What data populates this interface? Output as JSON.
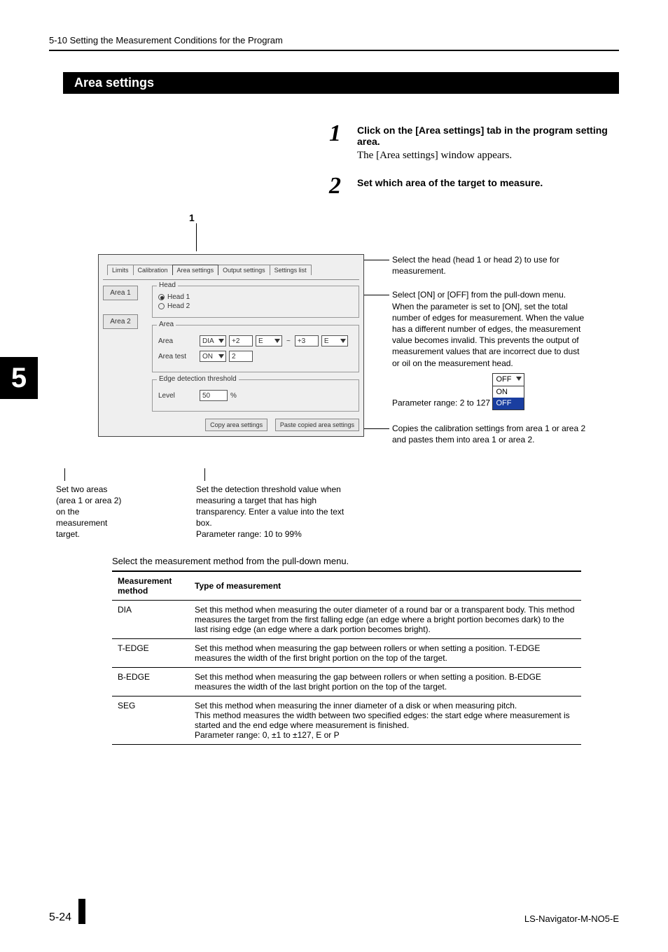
{
  "header": "5-10 Setting the Measurement Conditions for the Program",
  "chapter_tab": "5",
  "section_title": "Area settings",
  "steps": {
    "s1": {
      "num": "1",
      "bold": "Click on the [Area settings] tab in the program setting area.",
      "body": "The [Area settings] window appears."
    },
    "s2": {
      "num": "2",
      "bold": "Set which area of the target to measure."
    }
  },
  "callout_num": "1",
  "figure": {
    "tabs": {
      "t1": "Limits",
      "t2": "Calibration",
      "t3": "Area settings",
      "t4": "Output settings",
      "t5": "Settings list"
    },
    "area_buttons": {
      "a1": "Area 1",
      "a2": "Area 2"
    },
    "head_group": {
      "title": "Head",
      "h1": "Head 1",
      "h2": "Head 2"
    },
    "area_group": {
      "title": "Area",
      "row1_label": "Area",
      "row1_val": "DIA",
      "row1_e2": "+2",
      "row1_e2b": "E",
      "row1_tilde": "~",
      "row1_e3": "+3",
      "row1_e3b": "E",
      "row2_label": "Area test",
      "row2_val": "ON",
      "row2_num": "2"
    },
    "edge_group": {
      "title": "Edge detection threshold",
      "label": "Level",
      "val": "50",
      "unit": "%"
    },
    "buttons": {
      "copy": "Copy area settings",
      "paste": "Paste copied area settings"
    }
  },
  "annotations": {
    "head": "Select the head (head 1 or head 2) to use for measurement.",
    "areatest": "Select [ON] or [OFF] from the pull-down menu. When the parameter is set to [ON], set the total number of edges for measurement. When the value has a different number of edges, the measurement value becomes invalid. This prevents the output of measurement values that are incorrect due to dust or oil on the measurement head.\nParameter range: 2 to 127",
    "dd": {
      "top": "OFF",
      "r1": "ON",
      "r2": "OFF"
    },
    "copy": "Copies the calibration settings from area 1 or area 2 and pastes them into area 1 or area 2.",
    "left": "Set two areas (area 1 or area 2) on the measurement target.",
    "edge": "Set the detection threshold value when measuring a target that has high transparency. Enter a value into the text box.\nParameter range: 10 to 99%"
  },
  "table_caption": "Select the measurement method from the pull-down menu.",
  "table": {
    "h1": "Measurement method",
    "h2": "Type of measurement",
    "rows": {
      "r1": {
        "m": "DIA",
        "d": "Set this method when measuring the outer diameter of a round bar or a transparent body. This method measures the target from the first falling edge (an edge where a bright portion becomes dark) to the last rising edge (an edge where a dark portion becomes bright)."
      },
      "r2": {
        "m": "T-EDGE",
        "d": "Set this method when measuring the gap between rollers or when setting a position. T-EDGE measures the width of the first bright portion on the top of the target."
      },
      "r3": {
        "m": "B-EDGE",
        "d": "Set this method when measuring the gap between rollers or when setting a position. B-EDGE measures the width of the last bright portion on the top of the target."
      },
      "r4": {
        "m": "SEG",
        "d": "Set this method when measuring the inner diameter of a disk or when measuring pitch.\nThis method measures the width between two specified edges: the start edge where measurement is started and the end edge where measurement is finished.\nParameter range: 0, ±1 to ±127, E or P"
      }
    }
  },
  "footer": {
    "page": "5-24",
    "doc": "LS-Navigator-M-NO5-E"
  }
}
